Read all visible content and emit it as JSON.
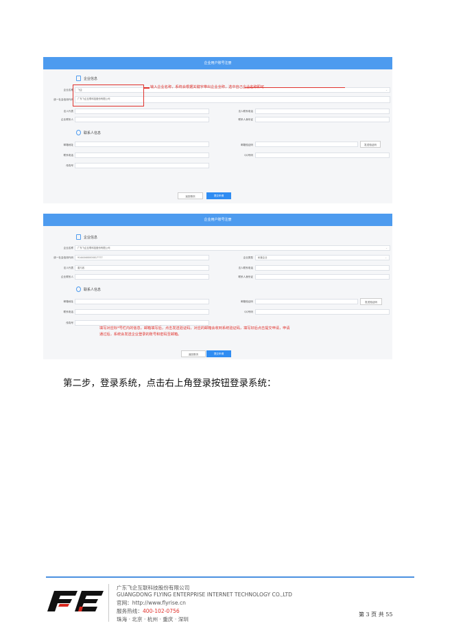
{
  "panel1": {
    "title": "企业用户账号注册",
    "section_company": "企业信息",
    "section_contact": "联系人信息",
    "fields": {
      "company_name_label": "企业名称",
      "company_name_value": "飞企",
      "credit_code_label": "统一社会信用代码",
      "credit_code_value": "广东飞企互联科技股份有限公司",
      "legal_rep_label": "法人代表",
      "legal_phone_label": "法人联系电话",
      "company_contact_label": "企业联系人",
      "contact_id_label": "联系人身份证",
      "email_label": "邮箱地址",
      "email_code_label": "邮箱验证码",
      "send_code_button": "发送验证码",
      "phone_label": "联系电话",
      "qq_label": "QQ号码",
      "fax_label": "传真号"
    },
    "annotation": "输入企业名称，系统会根据关键字带出企业全称，选中自己企业名称即可",
    "back_button": "返回首页",
    "submit_button": "提交申请"
  },
  "panel2": {
    "title": "企业用户账号注册",
    "section_company": "企业信息",
    "section_contact": "联系人信息",
    "fields": {
      "company_name_label": "企业名称",
      "company_name_value": "广东飞企互联科技股份有限公司",
      "credit_code_label": "统一社会信用代码",
      "credit_code_value": "91440400000017777",
      "company_type_label": "企业类型",
      "company_type_value": "私营企业",
      "legal_rep_label": "法人代表",
      "legal_rep_value": "曾凡政",
      "legal_phone_label": "法人联系电话",
      "company_contact_label": "企业联系人",
      "contact_id_label": "联系人身份证",
      "email_label": "邮箱地址",
      "email_code_label": "邮箱验证码",
      "send_code_button": "发送验证码",
      "phone_label": "联系电话",
      "qq_label": "QQ号码",
      "fax_label": "传真号"
    },
    "annotation_line1": "填写对应标*号栏内的信息，邮箱填写后，点击发送验证码，对应的邮箱会收到系统验证码，填写好后点击提交申请，申请",
    "annotation_line2": "通过后，系统会发送企业登录的账号和密码至邮箱。",
    "back_button": "返回首页",
    "submit_button": "提交申请"
  },
  "body_text": "第二步，登录系统，点击右上角登录按钮登录系统：",
  "footer": {
    "logo_text": "FE",
    "company_cn": "广东飞企互联科技股份有限公司",
    "company_en": "GUANGDONG FLYING ENTERPRISE INTERNET TECHNOLOGY CO.,LTD",
    "website_label": "官网：",
    "website": "http://www.flyrise.cn",
    "hotline_label": "服务热线：",
    "hotline": "400-102-0756",
    "cities": "珠海 · 北京 · 杭州 · 重庆 · 深圳",
    "page_number": "第 3 页 共 55"
  },
  "colors": {
    "header_blue": "#4d9bef",
    "annotation_red": "#e0312b",
    "footer_rule": "#4a8fe0",
    "logo_black": "#111111",
    "logo_red": "#d7261c"
  }
}
